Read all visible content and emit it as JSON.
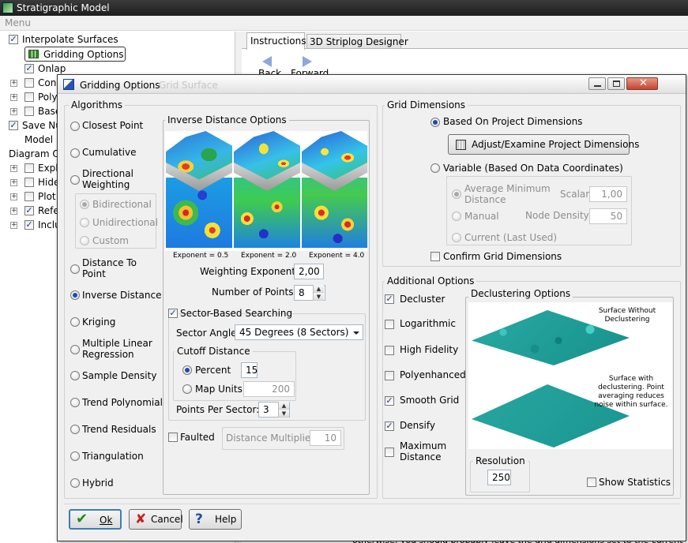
{
  "app": {
    "title": "Stratigraphic Model",
    "menu": "Menu"
  },
  "tree": {
    "interpolate": "Interpolate Surfaces",
    "gridding": "Gridding Options",
    "onlap": "Onlap",
    "cons": "Cons",
    "poly": "Poly",
    "base": "Base",
    "save": "Save Nu",
    "model": "Model",
    "diagram": "Diagram O",
    "expl": "Expl",
    "hide": "Hide",
    "plot": "Plot",
    "refe": "Refe",
    "incl": "Inclu"
  },
  "tabs": {
    "instructions": "Instructions",
    "striplog": "3D Striplog Designer",
    "back": "Back",
    "forward": "Forward",
    "surface_bg": "Grid Surface"
  },
  "dialog": {
    "title": "Gridding Options",
    "algorithms": {
      "label": "Algorithms",
      "closest": "Closest Point",
      "cumulative": "Cumulative",
      "directional": "Directional Weighting",
      "bidirectional": "Bidirectional",
      "unidirectional": "Unidirectional",
      "custom": "Custom",
      "distance_to_point": "Distance To Point",
      "inverse_distance": "Inverse Distance",
      "kriging": "Kriging",
      "mlr": "Multiple Linear Regression",
      "sample_density": "Sample Density",
      "trend_poly": "Trend Polynomial",
      "trend_resid": "Trend Residuals",
      "triangulation": "Triangulation",
      "hybrid": "Hybrid"
    },
    "idw": {
      "label": "Inverse Distance Options",
      "exp1": "Exponent = 0.5",
      "exp2": "Exponent = 2.0",
      "exp3": "Exponent = 4.0",
      "weighting_label": "Weighting Exponent:",
      "weighting_value": "2,00",
      "points_label": "Number of Points:",
      "points_value": "8",
      "sector_label": "Sector-Based Searching",
      "sector_angle_label": "Sector Angle",
      "sector_angle_value": "45 Degrees (8 Sectors)",
      "cutoff_label": "Cutoff Distance",
      "percent_label": "Percent",
      "percent_value": "15",
      "map_units_label": "Map Units",
      "map_units_value": "200",
      "pps_label": "Points Per Sector:",
      "pps_value": "3",
      "faulted_label": "Faulted",
      "dist_mult_label": "Distance Multiplier:",
      "dist_mult_value": "10"
    },
    "grid": {
      "label": "Grid Dimensions",
      "based_on_project": "Based On Project Dimensions",
      "adjust_btn": "Adjust/Examine Project Dimensions",
      "variable": "Variable (Based On Data Coordinates)",
      "avg_min": "Average Minimum Distance",
      "scalar_label": "Scalar:",
      "scalar_value": "1,00",
      "manual": "Manual",
      "node_density_label": "Node Density:",
      "node_density_value": "50",
      "current": "Current (Last Used)",
      "confirm": "Confirm Grid Dimensions"
    },
    "additional": {
      "label": "Additional Options",
      "decluster": "Decluster",
      "logarithmic": "Logarithmic",
      "high_fidelity": "High Fidelity",
      "polyenhanced": "Polyenhanced",
      "smooth_grid": "Smooth Grid",
      "densify": "Densify",
      "max_distance": "Maximum Distance",
      "declustering_label": "Declustering Options",
      "surface_without": "Surface Without Declustering",
      "surface_with": "Surface with declustering.  Point averaging reduces noise within surface.",
      "resolution_label": "Resolution",
      "resolution_value": "250",
      "show_stats": "Show Statistics"
    },
    "buttons": {
      "ok": "Ok",
      "cancel": "Cancel",
      "help": "Help"
    }
  },
  "bottom_text": "otherwise, you should probably leave the grid dimensions set to the current",
  "colors": {
    "accent": "#1a4bb0",
    "title_bar": "#2b2b2b",
    "dialog_bg": "#f0f0f0",
    "surface_teal": "#1f9e9a"
  }
}
